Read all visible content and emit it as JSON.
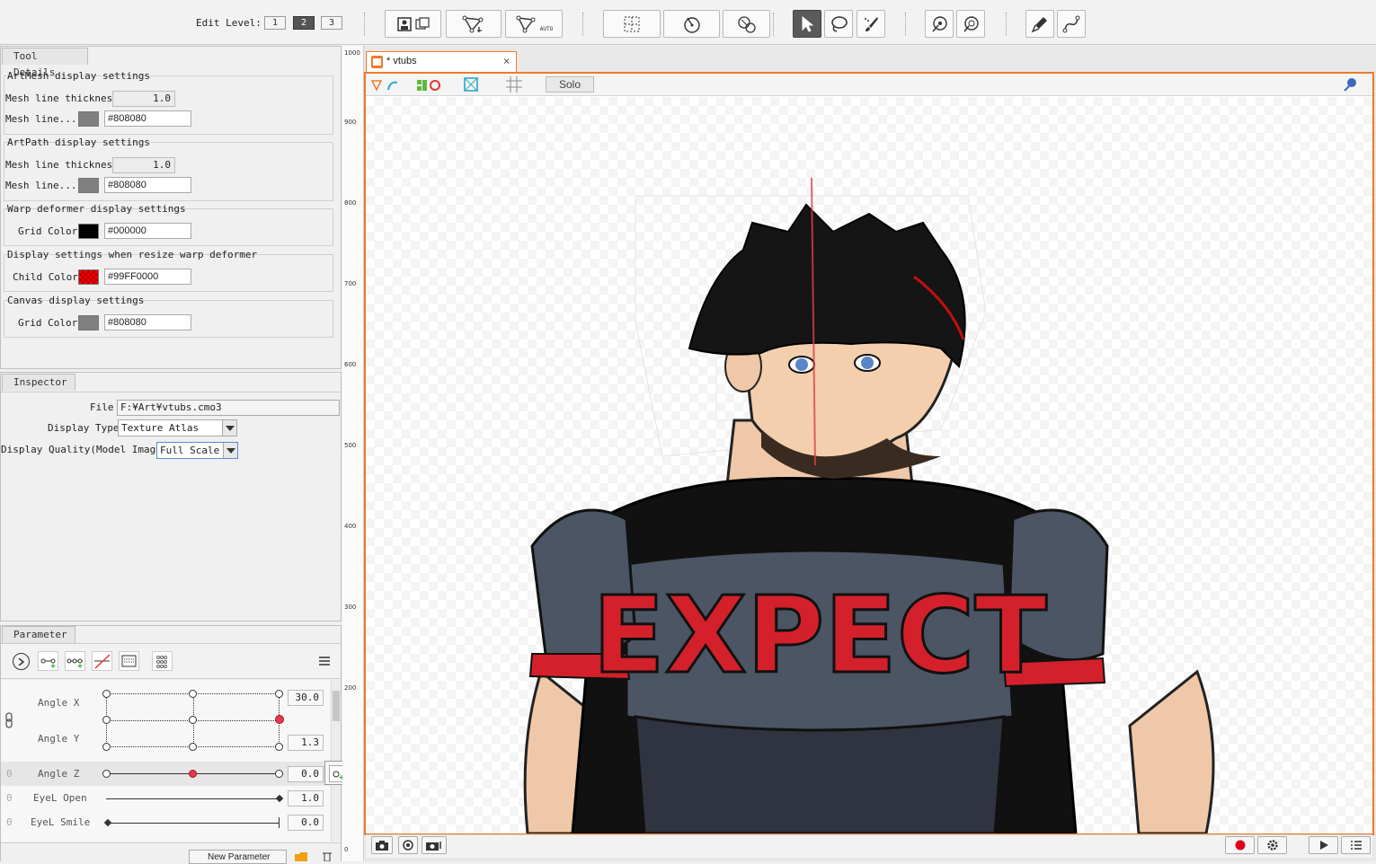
{
  "toolbar": {
    "edit_level_label": "Edit Level:",
    "levels": [
      "1",
      "2",
      "3"
    ],
    "auto_badge": "AUTO"
  },
  "tool_details": {
    "tab": "Tool Details",
    "artmesh": {
      "title": "ArtMesh display settings",
      "thickness_label": "Mesh line thickness",
      "thickness": "1.0",
      "color_label": "Mesh line...",
      "color": "#808080"
    },
    "artpath": {
      "title": "ArtPath display settings",
      "thickness_label": "Mesh line thickness",
      "thickness": "1.0",
      "color_label": "Mesh line...",
      "color": "#808080"
    },
    "warp": {
      "title": "Warp deformer display settings",
      "color_label": "Grid Color",
      "color": "#000000"
    },
    "resize": {
      "title": "Display settings when resize warp deformer",
      "color_label": "Child Color",
      "color": "#99FF0000"
    },
    "canvas": {
      "title": "Canvas display settings",
      "color_label": "Grid Color",
      "color": "#808080"
    }
  },
  "inspector": {
    "tab": "Inspector",
    "file_label": "File",
    "file_value": "F:¥Art¥vtubs.cmo3",
    "display_type_label": "Display Type",
    "display_type_value": "Texture Atlas",
    "quality_label": "Display Quality(Model Image)",
    "quality_value": "Full Scale"
  },
  "parameter": {
    "tab": "Parameter",
    "params": [
      {
        "name": "Angle X",
        "value": "30.0",
        "level": 1.0
      },
      {
        "name": "Angle Y",
        "value": "1.3",
        "level": 0.52
      },
      {
        "name": "Angle Z",
        "value": "0.0",
        "level": 0.5
      },
      {
        "name": "EyeL Open",
        "value": "1.0",
        "level": 1.0
      },
      {
        "name": "EyeL Smile",
        "value": "0.0",
        "level": 0.0
      }
    ],
    "new_button": "New Parameter"
  },
  "ruler": {
    "labels": [
      "1000",
      "900",
      "800",
      "700",
      "600",
      "500",
      "400",
      "300",
      "200",
      "0"
    ]
  },
  "canvas": {
    "tab_title": "* vtubs",
    "tab_close": "×",
    "solo_label": "Solo",
    "artwork_text": "EXPECT",
    "colors": {
      "accent": "#f07a2a",
      "record": "#e0001a"
    }
  }
}
